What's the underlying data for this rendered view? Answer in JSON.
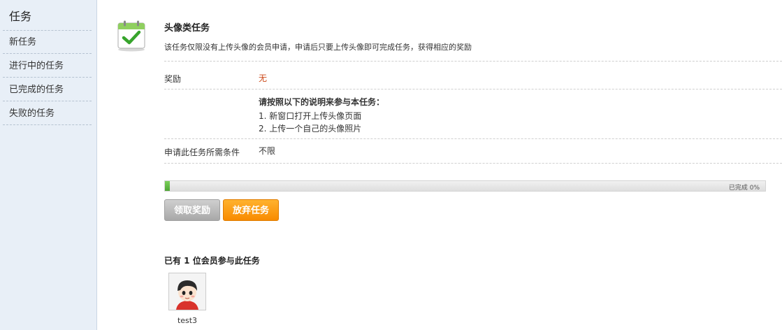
{
  "sidebar": {
    "title": "任务",
    "items": [
      {
        "label": "新任务"
      },
      {
        "label": "进行中的任务"
      },
      {
        "label": "已完成的任务"
      },
      {
        "label": "失败的任务"
      }
    ]
  },
  "task": {
    "icon": "calendar-check-icon",
    "title": "头像类任务",
    "description": "该任务仅限没有上传头像的会员申请，申请后只要上传头像即可完成任务，获得相应的奖励"
  },
  "details": {
    "reward_label": "奖励",
    "reward_value": "无",
    "instructions_title": "请按照以下的说明来参与本任务：",
    "steps": [
      "1. 新窗口打开上传头像页面",
      "2. 上传一个自己的头像照片"
    ],
    "condition_label": "申请此任务所需条件",
    "condition_value": "不限"
  },
  "progress": {
    "percent": 0,
    "label": "已完成 0%"
  },
  "buttons": {
    "claim": "领取奖励",
    "abandon": "放弃任务"
  },
  "participants": {
    "text": "已有  1 位会员参与此任务",
    "members": [
      {
        "name": "test3",
        "avatar": "cartoon-avatar"
      }
    ]
  },
  "colors": {
    "sidebar_bg": "#e8eff7",
    "reward_accent": "#cc4a1a",
    "progress_fill": "#5cb83f",
    "abandon_button": "#fb9a0d",
    "claim_button": "#b8b8b8"
  }
}
